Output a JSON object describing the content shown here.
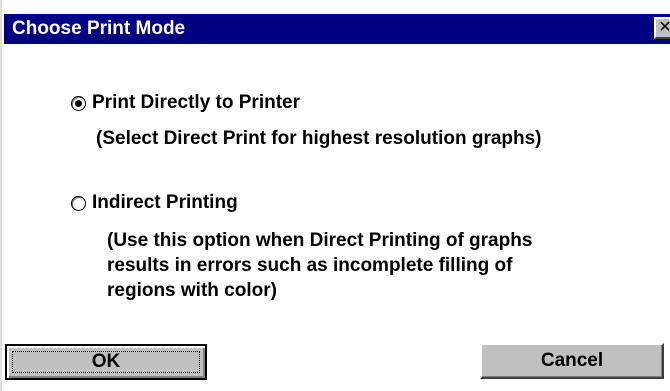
{
  "window": {
    "title": "Choose Print Mode",
    "close_glyph": "✕"
  },
  "options": [
    {
      "label": "Print Directly to Printer",
      "selected": true,
      "description": "(Select Direct Print for highest resolution graphs)"
    },
    {
      "label": "Indirect Printing",
      "selected": false,
      "description_lines": [
        "(Use this option when Direct Printing of graphs",
        "results in errors such as incomplete filling of",
        "regions with color)"
      ]
    }
  ],
  "buttons": {
    "ok_label": "OK",
    "cancel_label": "Cancel"
  },
  "colors": {
    "titlebar": "#000080",
    "button_face": "#c0c0c0"
  }
}
